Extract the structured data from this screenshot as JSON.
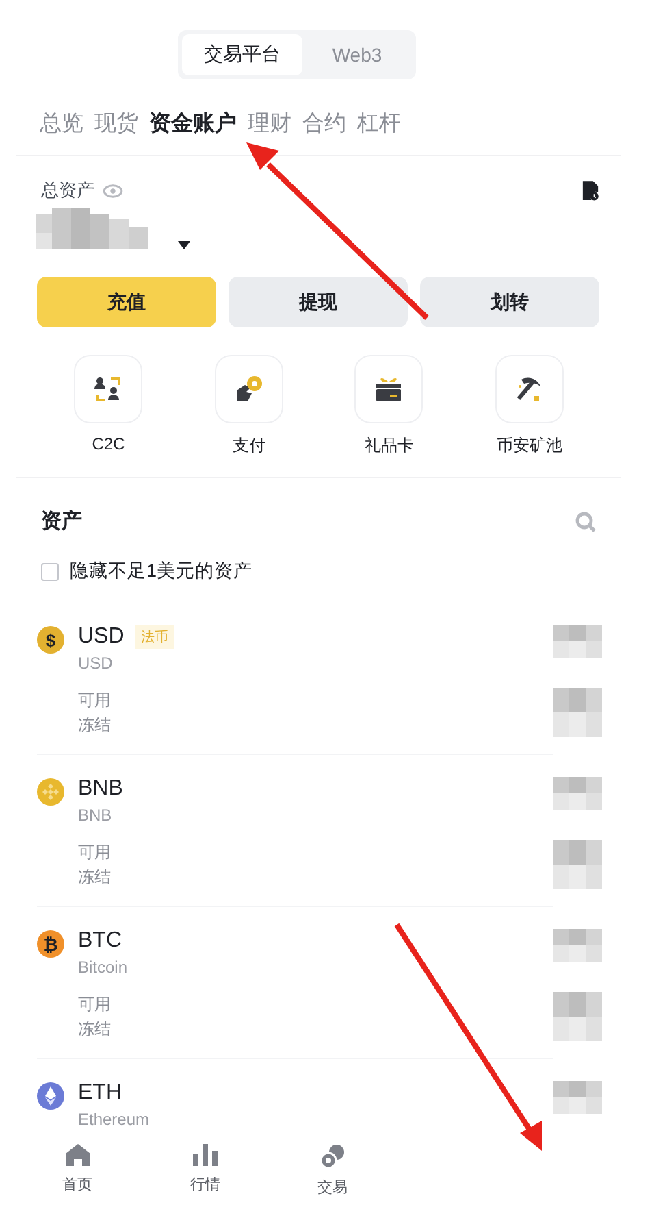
{
  "platform_switch": [
    {
      "label": "交易平台",
      "selected": true
    },
    {
      "label": "Web3",
      "selected": false
    }
  ],
  "tabs": [
    {
      "label": "总览",
      "selected": false
    },
    {
      "label": "现货",
      "selected": false
    },
    {
      "label": "资金账户",
      "selected": true
    },
    {
      "label": "理财",
      "selected": false
    },
    {
      "label": "合约",
      "selected": false
    },
    {
      "label": "杠杆",
      "selected": false
    }
  ],
  "total_assets": {
    "label": "总资产"
  },
  "actions": [
    {
      "label": "充值",
      "kind": "primary"
    },
    {
      "label": "提现",
      "kind": "secondary"
    },
    {
      "label": "划转",
      "kind": "secondary"
    }
  ],
  "shortcuts": [
    {
      "label": "C2C"
    },
    {
      "label": "支付"
    },
    {
      "label": "礼品卡"
    },
    {
      "label": "币安矿池"
    }
  ],
  "assets_section": {
    "title": "资产",
    "hide_small": {
      "label": "隐藏不足1美元的资产",
      "checked": false
    }
  },
  "assets": [
    {
      "symbol": "USD",
      "name": "USD",
      "tag": "法币",
      "kind": "glyph",
      "glyph": "$",
      "color": "#e3b130",
      "available_label": "可用",
      "frozen_label": "冻结"
    },
    {
      "symbol": "BNB",
      "name": "BNB",
      "kind": "bnb",
      "color": "#e8b82e",
      "available_label": "可用",
      "frozen_label": "冻结"
    },
    {
      "symbol": "BTC",
      "name": "Bitcoin",
      "kind": "glyph",
      "glyph": "₿",
      "color": "#f0902a",
      "available_label": "可用",
      "frozen_label": "冻结"
    },
    {
      "symbol": "ETH",
      "name": "Ethereum",
      "kind": "ether",
      "color": "#6b7bd6"
    }
  ],
  "bottom_nav": [
    {
      "label": "首页"
    },
    {
      "label": "行情"
    },
    {
      "label": "交易"
    }
  ]
}
